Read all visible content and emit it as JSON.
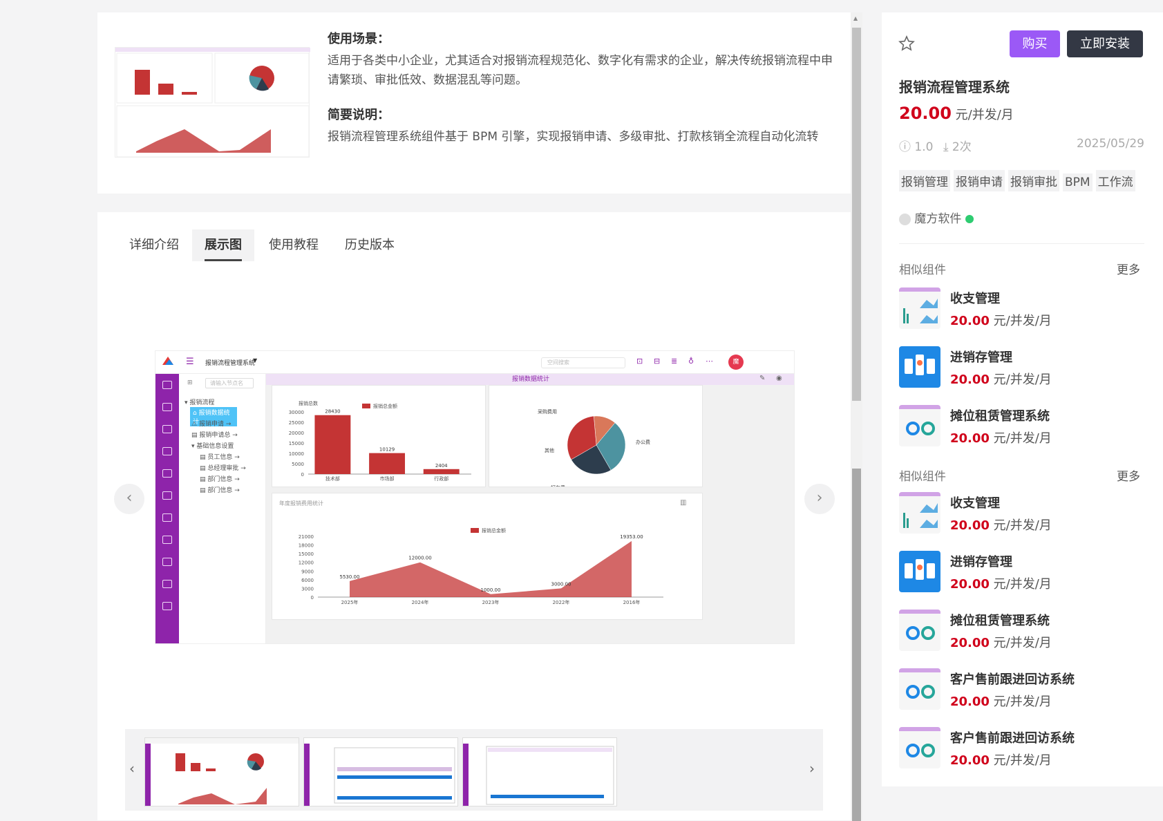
{
  "overview": {
    "scenario_title": "使用场景：",
    "scenario_text": "适用于各类中小企业，尤其适合对报销流程规范化、数字化有需求的企业，解决传统报销流程中申请繁琐、审批低效、数据混乱等问题。",
    "brief_title": "简要说明：",
    "brief_text": "报销流程管理系统组件基于 BPM 引擎，实现报销申请、多级审批、打款核销全流程自动化流转"
  },
  "tabs": [
    {
      "label": "详细介绍"
    },
    {
      "label": "展示图"
    },
    {
      "label": "使用教程"
    },
    {
      "label": "历史版本"
    }
  ],
  "gallery": {
    "prev_icon": "chevron-left-icon",
    "next_icon": "chevron-right-icon"
  },
  "screenshot": {
    "app_title": "报销流程管理系统",
    "search_placeholder": "空间搜索",
    "avatar": "魔",
    "tree_search": "请输入节点名",
    "tree_items": [
      "报销流程",
      "报销数据统计",
      "报销申请",
      "报销申请总",
      "基础信息设置",
      "员工信息",
      "总经理审批",
      "部门信息",
      "部门信息"
    ],
    "bar_title": "报销数据统计",
    "chart_data": [
      {
        "type": "bar",
        "categories": [
          "技术部",
          "市场部",
          "行政部"
        ],
        "values": [
          28430,
          10129,
          2404
        ],
        "ylabel": "报销总数",
        "legend": [
          "报销总金额"
        ],
        "ylim": [
          0,
          30000
        ],
        "yticks": [
          0,
          5000,
          10000,
          15000,
          20000,
          25000,
          30000
        ],
        "color": "#c43434"
      },
      {
        "type": "pie",
        "labels": [
          "采购费用",
          "其他",
          "打车费",
          "办公费"
        ],
        "colors": [
          "#d9785a",
          "#4d93a0",
          "#2d3d4d",
          "#c43434"
        ]
      },
      {
        "type": "area",
        "title": "年度报销费用统计",
        "categories": [
          "2025年",
          "2024年",
          "2023年",
          "2022年",
          "2016年"
        ],
        "values": [
          5530.0,
          12000.0,
          1000.0,
          3000.0,
          19353.0
        ],
        "legend": [
          "报销总金额"
        ],
        "ylim": [
          0,
          21000
        ],
        "yticks": [
          0,
          3000,
          6000,
          9000,
          12000,
          15000,
          18000,
          21000
        ],
        "color": "#c43434"
      }
    ]
  },
  "sidebar": {
    "title": "报销流程管理系统",
    "price": "20.00",
    "price_unit": "元/并发/月",
    "buy_label": "购买",
    "install_label": "立即安装",
    "version": "1.0",
    "downloads": "2次",
    "date": "2025/05/29",
    "tags": [
      "报销管理",
      "报销申请",
      "报销审批",
      "BPM",
      "工作流"
    ],
    "vendor": "魔方软件",
    "similar_title": "相似组件",
    "more_label": "更多",
    "similar": [
      {
        "name": "收支管理",
        "price": "20.00",
        "unit": "元/并发/月"
      },
      {
        "name": "进销存管理",
        "price": "20.00",
        "unit": "元/并发/月"
      },
      {
        "name": "摊位租赁管理系统",
        "price": "20.00",
        "unit": "元/并发/月"
      }
    ],
    "similar2_title": "相似组件",
    "similar2": [
      {
        "name": "收支管理",
        "price": "20.00",
        "unit": "元/并发/月"
      },
      {
        "name": "进销存管理",
        "price": "20.00",
        "unit": "元/并发/月"
      },
      {
        "name": "摊位租赁管理系统",
        "price": "20.00",
        "unit": "元/并发/月"
      },
      {
        "name": "客户售前跟进回访系统",
        "price": "20.00",
        "unit": "元/并发/月"
      },
      {
        "name": "客户售前跟进回访系统",
        "price": "20.00",
        "unit": "元/并发/月"
      }
    ]
  }
}
